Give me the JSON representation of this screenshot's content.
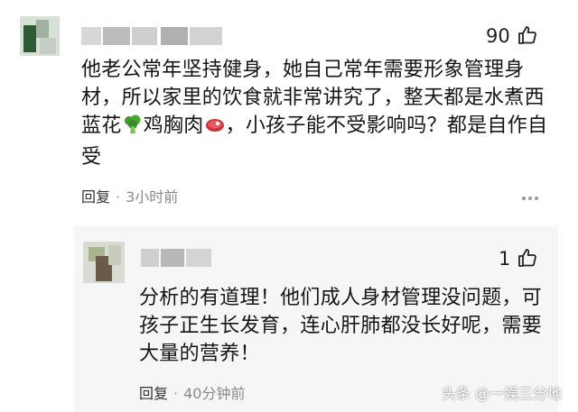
{
  "comment": {
    "likes": "90",
    "text_before": "他老公常年坚持健身，她自己常年需要形象管理身材，所以家里的饮食就非常讲究了，整天都是水煮西蓝花",
    "text_middle": "鸡胸肉",
    "text_after": "，小孩子能不受影响吗？都是自作自受",
    "emoji1": "broccoli-emoji",
    "emoji2": "meat-emoji",
    "reply_label": "回复",
    "time": "3小时前"
  },
  "reply": {
    "likes": "1",
    "text": "分析的有道理！他们成人身材管理没问题，可孩子正生长发育，连心肝肺都没长好呢，需要大量的营养！",
    "reply_label": "回复",
    "time": "40分钟前"
  },
  "watermark": {
    "text": "头条 @一娱三分地"
  },
  "colors": {
    "text": "#151515",
    "meta": "#8a8a8a",
    "reply_bg": "#f6f6f6",
    "broccoli": "#3f9a2a",
    "meat": "#c9343a"
  }
}
